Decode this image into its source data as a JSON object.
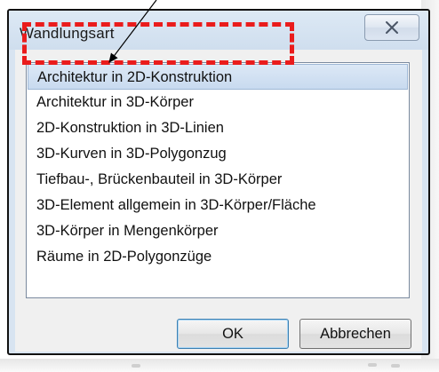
{
  "window": {
    "title": "Wandlungsart"
  },
  "titlebar": {
    "close_icon": "close-icon"
  },
  "list": {
    "items": [
      {
        "label": "Architektur in 2D-Konstruktion",
        "selected": true
      },
      {
        "label": "Architektur in 3D-Körper",
        "selected": false
      },
      {
        "label": "2D-Konstruktion in 3D-Linien",
        "selected": false
      },
      {
        "label": "3D-Kurven in 3D-Polygonzug",
        "selected": false
      },
      {
        "label": "Tiefbau-, Brückenbauteil in 3D-Körper",
        "selected": false
      },
      {
        "label": "3D-Element allgemein in 3D-Körper/Fläche",
        "selected": false
      },
      {
        "label": "3D-Körper in Mengenkörper",
        "selected": false
      },
      {
        "label": "Räume in 2D-Polygonzüge",
        "selected": false
      }
    ]
  },
  "buttons": {
    "ok_label": "OK",
    "cancel_label": "Abbrechen"
  },
  "annotation": {
    "highlight_color": "#ea1c1c",
    "arrow_color": "#000000"
  },
  "colors": {
    "titlebar": "#d8e4f1",
    "selection": "#c8daef",
    "default_button_border": "#3c7fb1"
  }
}
